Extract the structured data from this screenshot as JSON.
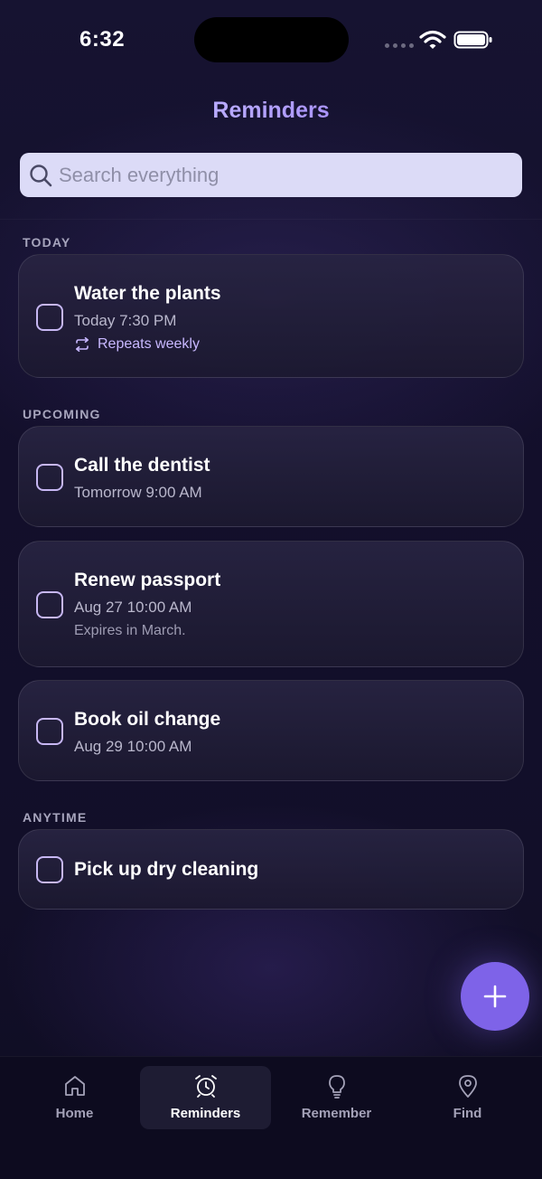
{
  "status_bar": {
    "time": "6:32"
  },
  "header": {
    "title": "Reminders"
  },
  "search": {
    "placeholder": "Search everything"
  },
  "sections": {
    "today": {
      "label": "TODAY",
      "items": [
        {
          "title": "Water the plants",
          "time": "Today 7:30 PM",
          "repeat": "Repeats weekly"
        }
      ]
    },
    "upcoming": {
      "label": "UPCOMING",
      "items": [
        {
          "title": "Call the dentist",
          "time": "Tomorrow 9:00 AM"
        },
        {
          "title": "Renew passport",
          "time": "Aug 27 10:00 AM",
          "note": "Expires in March."
        },
        {
          "title": "Book oil change",
          "time": "Aug 29 10:00 AM"
        }
      ]
    },
    "anytime": {
      "label": "ANYTIME",
      "items": [
        {
          "title": "Pick up dry cleaning"
        }
      ]
    }
  },
  "tabs": [
    {
      "label": "Home",
      "icon": "home-icon"
    },
    {
      "label": "Reminders",
      "icon": "alarm-clock-icon",
      "active": true
    },
    {
      "label": "Remember",
      "icon": "lightbulb-icon"
    },
    {
      "label": "Find",
      "icon": "map-pin-icon"
    }
  ],
  "colors": {
    "accent": "#7e63e8",
    "checkbox_border": "#c7b7f3",
    "search_bg": "#dcdbf7",
    "background": "#130f2b"
  }
}
